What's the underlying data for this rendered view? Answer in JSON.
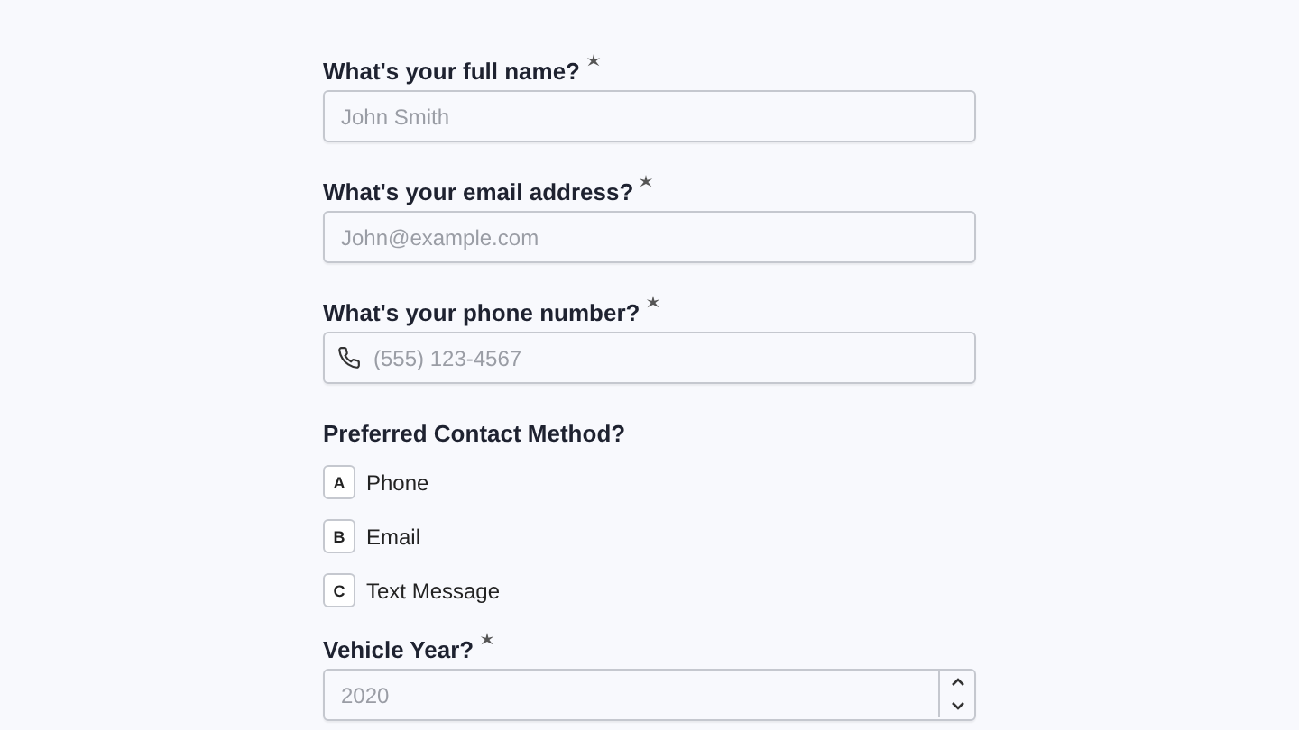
{
  "fields": [
    {
      "kind": "text",
      "label": "What's your full name?",
      "required": true,
      "placeholder": "John Smith"
    },
    {
      "kind": "text",
      "label": "What's your email address?",
      "required": true,
      "placeholder": "John@example.com"
    },
    {
      "kind": "phone",
      "label": "What's your phone number?",
      "required": true,
      "placeholder": "(555) 123-4567"
    },
    {
      "kind": "choice",
      "label": "Preferred Contact Method?",
      "required": false,
      "options": [
        {
          "key": "A",
          "label": "Phone",
          "selected": false
        },
        {
          "key": "B",
          "label": "Email",
          "selected": false
        },
        {
          "key": "C",
          "label": "Text Message",
          "selected": false
        }
      ]
    },
    {
      "kind": "number",
      "label": "Vehicle Year?",
      "required": true,
      "placeholder": "2020"
    }
  ]
}
